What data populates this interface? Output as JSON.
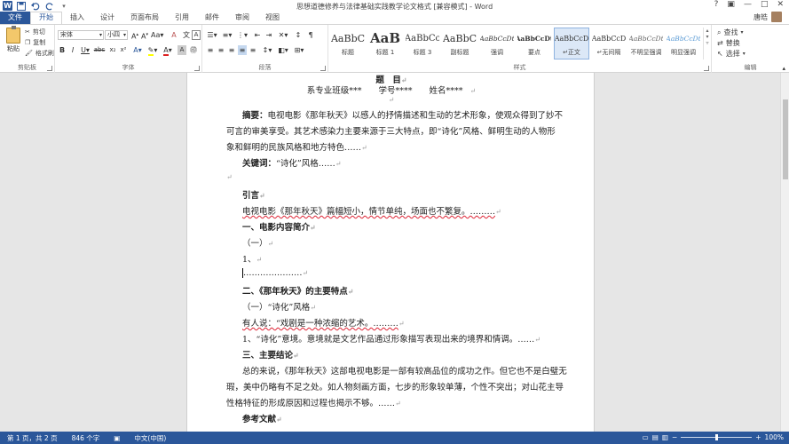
{
  "app": {
    "title": "思想道德修养与法律基础实践教学论文格式 [兼容模式] - Word",
    "user_name": "唐皓"
  },
  "tabs": [
    {
      "label": "文件"
    },
    {
      "label": "开始"
    },
    {
      "label": "插入"
    },
    {
      "label": "设计"
    },
    {
      "label": "页面布局"
    },
    {
      "label": "引用"
    },
    {
      "label": "邮件"
    },
    {
      "label": "审阅"
    },
    {
      "label": "视图"
    }
  ],
  "ribbon": {
    "clipboard": {
      "paste": "粘贴",
      "cut": "剪切",
      "copy": "复制",
      "format_painter": "格式刷",
      "label": "剪贴板"
    },
    "font": {
      "font_name": "宋体",
      "font_size": "小四",
      "label": "字体"
    },
    "paragraph": {
      "label": "段落"
    },
    "styles": {
      "label": "样式",
      "items": [
        {
          "sample": "AaBbC",
          "name": "标题"
        },
        {
          "sample": "AaB",
          "name": "标题 1"
        },
        {
          "sample": "AaBbCc",
          "name": "标题 3"
        },
        {
          "sample": "AaBbC",
          "name": "副标题"
        },
        {
          "sample": "AaBbCcDt",
          "name": "强调"
        },
        {
          "sample": "AaBbCcDt",
          "name": "要点"
        },
        {
          "sample": "AaBbCcD",
          "name": "↵正文"
        },
        {
          "sample": "AaBbCcD",
          "name": "↵无间隔"
        },
        {
          "sample": "AaBbCcDt",
          "name": "不明显强调"
        },
        {
          "sample": "AaBbCcDt",
          "name": "明显强调"
        }
      ]
    },
    "editing": {
      "find": "查找",
      "replace": "替换",
      "select": "选择",
      "label": "编辑"
    }
  },
  "document": {
    "lines": [
      {
        "text": "题　目",
        "style": "title"
      },
      {
        "text": "系专业班级***　　学号****　　姓名****",
        "style": "subtitle"
      },
      {
        "text": "",
        "style": "blank"
      },
      {
        "label": "摘要：",
        "text": "电视电影《那年秋天》以感人的抒情描述和生动的艺术形象，使观众得到了妙不",
        "style": "body-indent"
      },
      {
        "text": "可言的审美享受。其艺术感染力主要来源于三大特点，即“诗化”风格、鲜明生动的人物形",
        "style": "body"
      },
      {
        "text": "象和鲜明的民族风格和地方特色……",
        "style": "body"
      },
      {
        "label": "关键词：",
        "text": "“诗化”风格……",
        "style": "body-indent"
      },
      {
        "text": "",
        "style": "blank"
      },
      {
        "text": "引言",
        "style": "heading"
      },
      {
        "text": "电视电影《那年秋天》篇幅短小，情节单纯，场面也不繁复。………",
        "style": "body-indent"
      },
      {
        "text": "一、电影内容简介",
        "style": "heading"
      },
      {
        "text": "（一）",
        "style": "body-indent"
      },
      {
        "text": "1、",
        "style": "body-indent"
      },
      {
        "text": "…………………",
        "style": "body-indent"
      },
      {
        "text": "二、《那年秋天》的主要特点",
        "style": "heading"
      },
      {
        "text": "（一）“诗化”风格",
        "style": "body-indent"
      },
      {
        "text": "有人说：“戏剧是一种浓缩的艺术。………",
        "style": "body-indent"
      },
      {
        "text": "1、“诗化”意境。意境就是文艺作品通过形象描写表现出来的境界和情调。……",
        "style": "body-indent"
      },
      {
        "text": "三、主要结论",
        "style": "heading"
      },
      {
        "text": "总的来说，《那年秋天》这部电视电影是一部有较高品位的成功之作。但它也不是白璧无",
        "style": "body-indent"
      },
      {
        "text": "瑕，美中仍略有不足之处。如人物刻画方面，七步的形象较单薄，个性不突出；对山花主导",
        "style": "body"
      },
      {
        "text": "性格特征的形成原因和过程也揭示不够。……",
        "style": "body"
      },
      {
        "text": "参考文献",
        "style": "heading"
      }
    ]
  },
  "statusbar": {
    "page": "第 1 页，共 2 页",
    "words": "846 个字",
    "language": "中文(中国)",
    "zoom": "100%"
  }
}
